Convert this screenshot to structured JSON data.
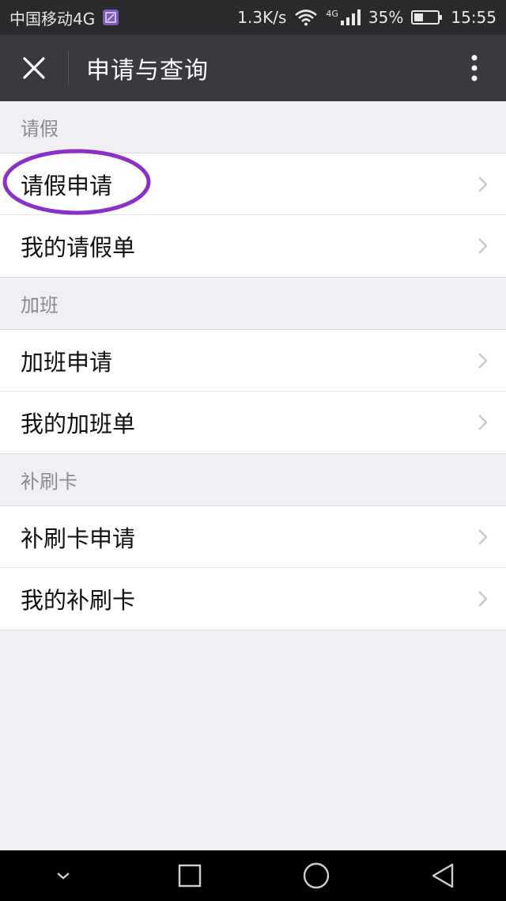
{
  "status_bar": {
    "carrier": "中国移动4G",
    "network_speed": "1.3K/s",
    "network_type": "4G",
    "battery": "35%",
    "time": "15:55"
  },
  "header": {
    "title": "申请与查询"
  },
  "sections": [
    {
      "title": "请假",
      "items": [
        "请假申请",
        "我的请假单"
      ]
    },
    {
      "title": "加班",
      "items": [
        "加班申请",
        "我的加班单"
      ]
    },
    {
      "title": "补刷卡",
      "items": [
        "补刷卡申请",
        "我的补刷卡"
      ]
    }
  ],
  "colors": {
    "header_bg": "#393a3f",
    "status_bg": "#2a2a2c",
    "page_bg": "#efeff4",
    "highlight": "#8b2fc9"
  }
}
